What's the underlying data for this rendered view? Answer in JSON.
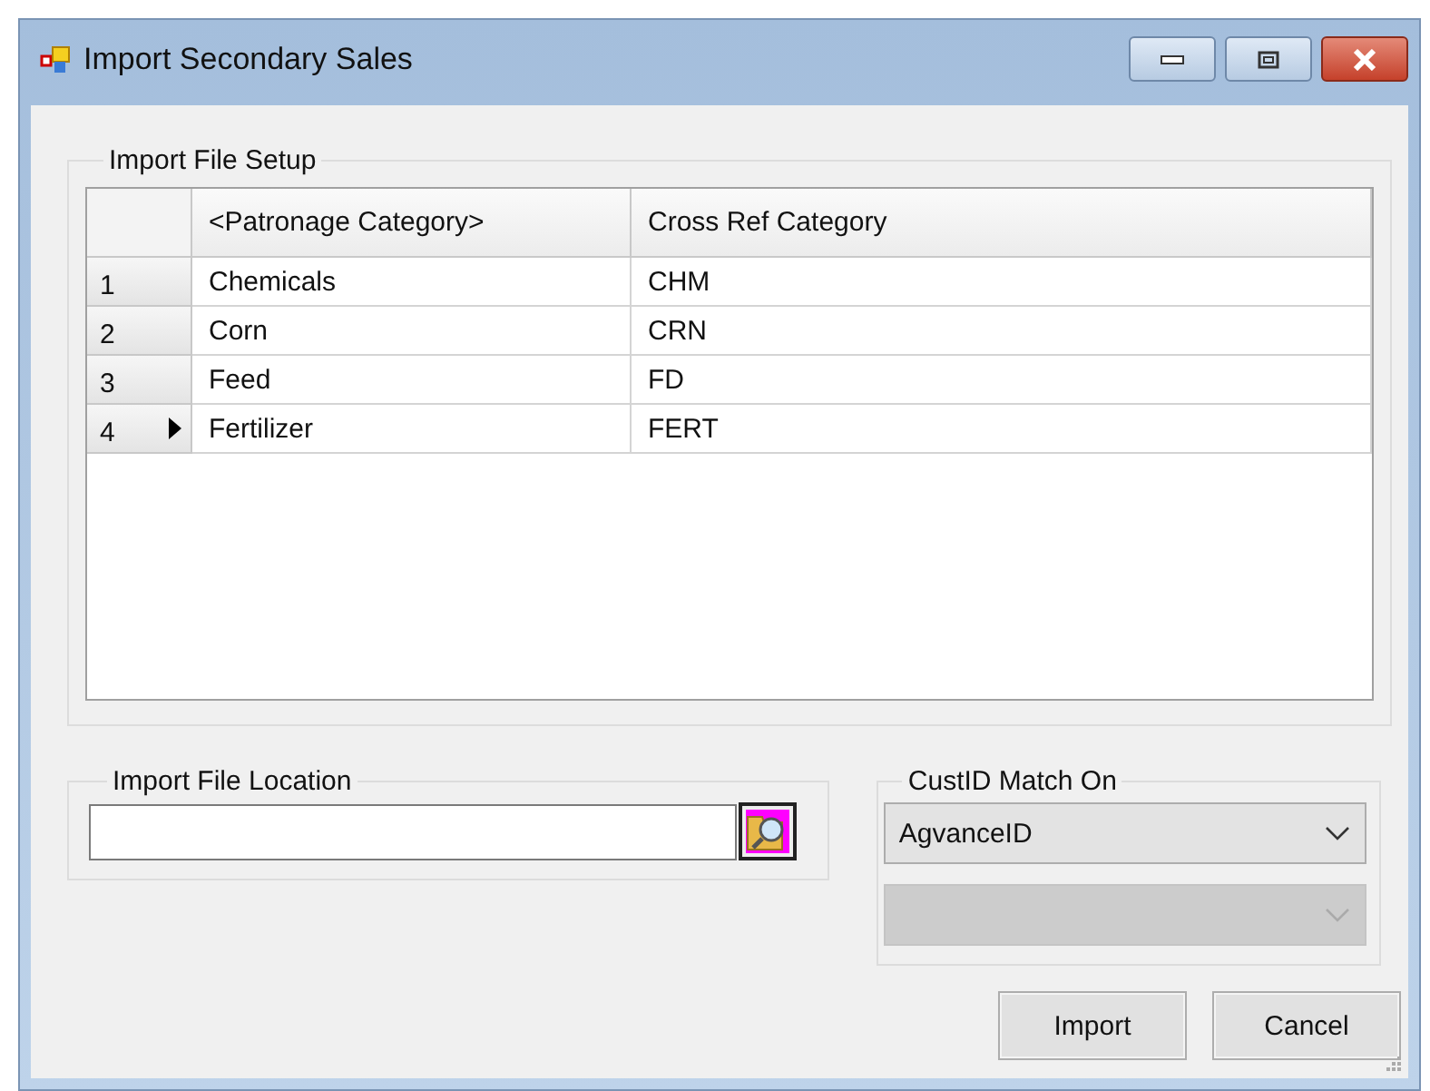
{
  "window": {
    "title": "Import Secondary Sales"
  },
  "setup": {
    "title": "Import File Setup",
    "columns": [
      "<Patronage Category>",
      "Cross Ref Category"
    ],
    "rows": [
      {
        "number": "1",
        "category": "Chemicals",
        "cross_ref": "CHM",
        "selected": false
      },
      {
        "number": "2",
        "category": "Corn",
        "cross_ref": "CRN",
        "selected": false
      },
      {
        "number": "3",
        "category": "Feed",
        "cross_ref": "FD",
        "selected": false
      },
      {
        "number": "4",
        "category": "Fertilizer",
        "cross_ref": "FERT",
        "selected": true
      }
    ]
  },
  "file_location": {
    "title": "Import File Location"
  },
  "match": {
    "title": "CustID Match On",
    "combos": [
      {
        "value": "AgvanceID",
        "disabled": false
      },
      {
        "disabled": true
      }
    ]
  },
  "buttons": [
    "Import",
    "Cancel"
  ]
}
